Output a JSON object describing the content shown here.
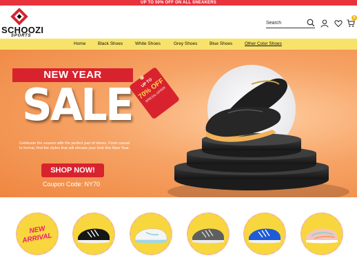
{
  "promo_bar": {
    "text": "UP TO 50% OFF ON ALL SNEAKERS"
  },
  "brand": {
    "name": "SCHOOZI",
    "tagline": "SPORTS"
  },
  "search": {
    "placeholder": "Search"
  },
  "header_icons": [
    "search-icon",
    "user-icon",
    "heart-icon",
    "cart-icon"
  ],
  "cart": {
    "count": "0"
  },
  "nav": {
    "items": [
      {
        "label": "Home"
      },
      {
        "label": "Black Shoes"
      },
      {
        "label": "White Shoes"
      },
      {
        "label": "Grey Shoes"
      },
      {
        "label": "Blue Shoes"
      },
      {
        "label": "Other Color Shoes"
      }
    ],
    "active_index": 5
  },
  "hero": {
    "ribbon": "NEW YEAR",
    "headline": "SALE",
    "tag": {
      "line1": "UP TO",
      "line2": "70% OFF",
      "line3": "SPECIAL OFFER"
    },
    "description": "Celebrate the season with the perfect pair of shoes. From casual to formal, find the styles that will elevate your look this New Year.",
    "cta": "SHOP NOW!",
    "coupon": "Coupon Code: NY70"
  },
  "categories": [
    {
      "label_line1": "NEW",
      "label_line2": "ARRIVAL"
    },
    {
      "shoe": "black-sneaker"
    },
    {
      "shoe": "white-sneaker"
    },
    {
      "shoe": "grey-sneaker"
    },
    {
      "shoe": "blue-sneaker"
    },
    {
      "shoe": "multicolor-sneaker"
    }
  ],
  "colors": {
    "promo_red": "#e8323c",
    "nav_yellow": "#f7e36a",
    "hero_orange": "#f6a365",
    "cta_red": "#d8232f",
    "category_yellow": "#f7d73d",
    "badge_yellow": "#f5b800"
  }
}
